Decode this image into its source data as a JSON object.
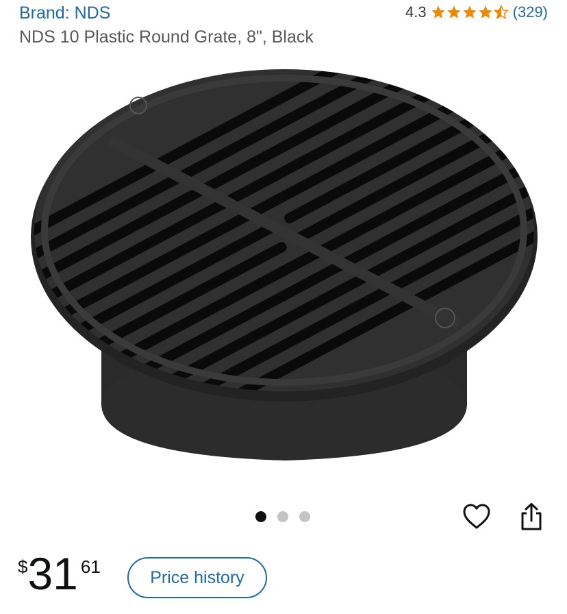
{
  "brand": {
    "label": "Brand: NDS"
  },
  "rating": {
    "value": "4.3",
    "stars": 4.3,
    "count": "(329)",
    "star_color": "#f08804"
  },
  "product": {
    "title": "NDS 10 Plastic Round Grate, 8\", Black",
    "image_icon": "drain-grate-image"
  },
  "carousel": {
    "total": 3,
    "active": 1
  },
  "actions": {
    "wishlist_icon": "heart-icon",
    "share_icon": "share-icon"
  },
  "price": {
    "symbol": "$",
    "whole": "31",
    "fraction": "61"
  },
  "price_history": {
    "label": "Price history"
  },
  "colors": {
    "link": "#1f6aa5",
    "text": "#0f1111",
    "secondary_text": "#565959"
  }
}
